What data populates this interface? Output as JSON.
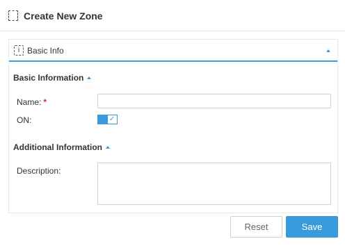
{
  "header": {
    "title": "Create New Zone",
    "icon": "dashed-zone-icon"
  },
  "card": {
    "title": "Basic Info",
    "icon": "info-icon",
    "sections": {
      "basic": {
        "title": "Basic Information",
        "name_label": "Name:",
        "required_mark": "*",
        "name_value": "",
        "on_label": "ON:",
        "on_state": true
      },
      "additional": {
        "title": "Additional Information",
        "description_label": "Description:",
        "description_value": ""
      }
    }
  },
  "actions": {
    "reset_label": "Reset",
    "save_label": "Save"
  },
  "colors": {
    "accent": "#3a9bdc",
    "required": "#d9302c",
    "border": "#cfcfcf"
  }
}
